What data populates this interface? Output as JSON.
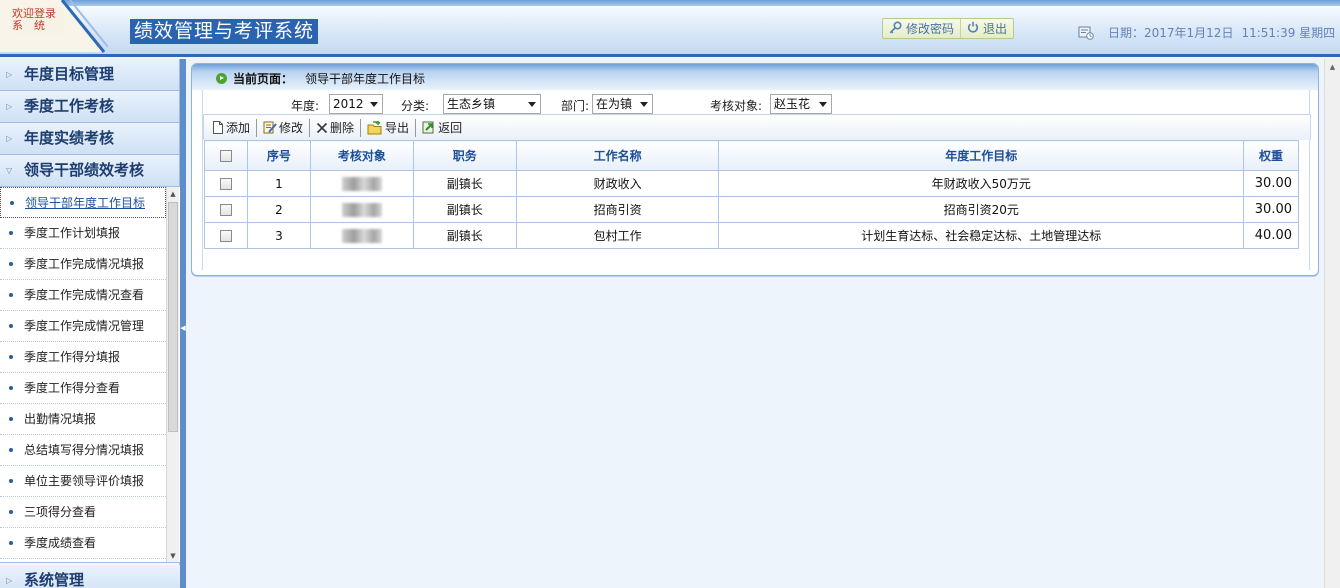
{
  "header": {
    "welcome_line1": "欢迎登录",
    "welcome_line2": "系　统",
    "title": "绩效管理与考评系统",
    "actions": [
      {
        "label": "修改密码",
        "icon": "key-icon"
      },
      {
        "label": "退出",
        "icon": "power-icon"
      }
    ],
    "date_label": "日期：2017年1月12日",
    "time_label": "11:51:39 星期四",
    "date_icon": "calendar-clock-icon"
  },
  "sidebar": {
    "sections": [
      {
        "label": "年度目标管理",
        "expanded": false
      },
      {
        "label": "季度工作考核",
        "expanded": false
      },
      {
        "label": "年度实绩考核",
        "expanded": false
      },
      {
        "label": "领导干部绩效考核",
        "expanded": true
      }
    ],
    "items": [
      {
        "label": "领导干部年度工作目标",
        "active": true
      },
      {
        "label": "季度工作计划填报"
      },
      {
        "label": "季度工作完成情况填报"
      },
      {
        "label": "季度工作完成情况查看"
      },
      {
        "label": "季度工作完成情况管理"
      },
      {
        "label": "季度工作得分填报"
      },
      {
        "label": "季度工作得分查看"
      },
      {
        "label": "出勤情况填报"
      },
      {
        "label": "总结填写得分情况填报"
      },
      {
        "label": "单位主要领导评价填报"
      },
      {
        "label": "三项得分查看"
      },
      {
        "label": "季度成绩查看"
      }
    ],
    "bottom_section": {
      "label": "系统管理"
    }
  },
  "breadcrumb": {
    "label": "当前页面：",
    "value": "领导干部年度工作目标"
  },
  "filters": {
    "year_label": "年度:",
    "year_value": "2012",
    "category_label": "分类:",
    "category_value": "生态乡镇",
    "dept_label": "部门:",
    "dept_value": "在为镇",
    "target_label": "考核对象:",
    "target_value": "赵玉花"
  },
  "toolbar": {
    "add": "添加",
    "edit": "修改",
    "delete": "删除",
    "export": "导出",
    "back": "返回"
  },
  "table": {
    "headers": [
      "序号",
      "考核对象",
      "职务",
      "工作名称",
      "年度工作目标",
      "权重"
    ],
    "rows": [
      {
        "no": "1",
        "target": "",
        "position": "副镇长",
        "work": "财政收入",
        "goal": "年财政收入50万元",
        "weight": "30.00"
      },
      {
        "no": "2",
        "target": "",
        "position": "副镇长",
        "work": "招商引资",
        "goal": "招商引资20元",
        "weight": "30.00"
      },
      {
        "no": "3",
        "target": "",
        "position": "副镇长",
        "work": "包村工作",
        "goal": "计划生育达标、社会稳定达标、土地管理达标",
        "weight": "40.00"
      }
    ]
  },
  "colors": {
    "brand": "#2a63b0",
    "header_text": "#1d4f99",
    "border": "#aec6e4"
  }
}
